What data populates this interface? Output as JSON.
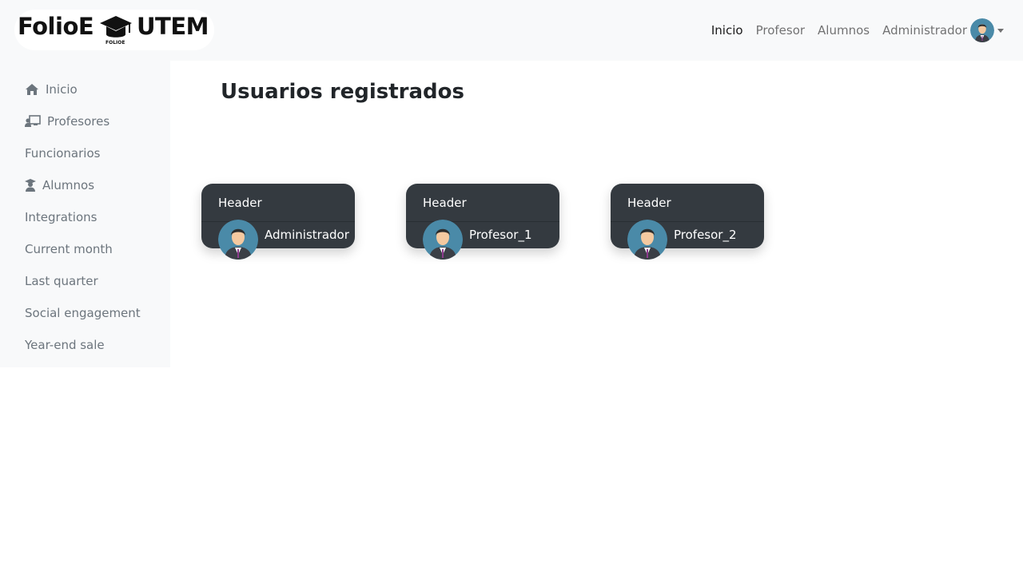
{
  "brand": {
    "left": "FolioE",
    "right": "UTEM",
    "sub": "FOLIOE"
  },
  "navbar": {
    "links": [
      {
        "label": "Inicio",
        "active": true
      },
      {
        "label": "Profesor",
        "active": false
      },
      {
        "label": "Alumnos",
        "active": false
      }
    ],
    "user_label": "Administrador",
    "user_icon": "user-avatar-icon"
  },
  "sidebar": {
    "items": [
      {
        "label": "Inicio",
        "icon": "home-icon"
      },
      {
        "label": "Profesores",
        "icon": "chalkboard-teacher-icon"
      },
      {
        "label": "Funcionarios",
        "icon": ""
      },
      {
        "label": "Alumnos",
        "icon": "user-graduate-icon"
      },
      {
        "label": "Integrations",
        "icon": ""
      },
      {
        "label": "Current month",
        "icon": ""
      },
      {
        "label": "Last quarter",
        "icon": ""
      },
      {
        "label": "Social engagement",
        "icon": ""
      },
      {
        "label": "Year-end sale",
        "icon": ""
      }
    ]
  },
  "main": {
    "title": "Usuarios registrados",
    "cards": [
      {
        "header": "Header",
        "name": "Administrador"
      },
      {
        "header": "Header",
        "name": "Profesor_1"
      },
      {
        "header": "Header",
        "name": "Profesor_2"
      }
    ]
  },
  "colors": {
    "navbar_bg": "#f8f9fa",
    "card_bg": "#343a40",
    "avatar_bg": "#4a8aa8"
  }
}
